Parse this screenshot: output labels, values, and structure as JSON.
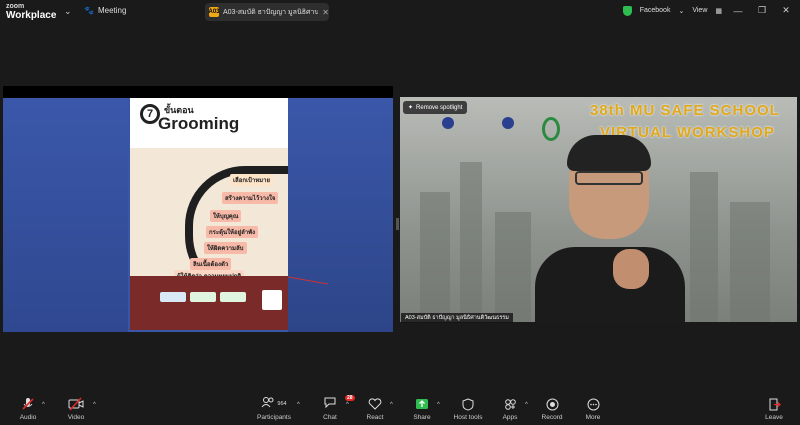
{
  "app": {
    "brand_line1": "zoom",
    "brand_line2": "Workplace"
  },
  "titlebar": {
    "meeting_label": "Meeting",
    "meeting_tab_icon": "A03",
    "meeting_tab_text": "A03-สมบัติ ธาปัญญา มูลนิธิศานติวัฒ",
    "facebook_label": "Facebook",
    "view_label": "View",
    "shield_color": "#2ebd4e"
  },
  "shared_screen": {
    "poster_number": "7",
    "poster_heading_top": "ขั้นตอน",
    "poster_heading_main": "Grooming",
    "steps": [
      "เลือกเป้าหมาย",
      "สร้างความไว้วางใจ",
      "ให้บุญคุณ",
      "กระตุ้นให้อยู่ลำพัง",
      "ให้ผิดความลับ",
      "ลินเนื้อต้องตัว",
      "ผู้ให้คิดว่า ความหยุมปกติ"
    ]
  },
  "video": {
    "spotlight_button": "Remove spotlight",
    "banner_line1": "38th MU SAFE SCHOOL",
    "banner_line2": "VIRTUAL WORKSHOP",
    "participant_name": "A03-สมบัติ ธาปัญญา มูลนิธิศานติวัฒนธรรม"
  },
  "toolbar": {
    "audio": "Audio",
    "video": "Video",
    "participants": "Participants",
    "participants_count": "964",
    "chat": "Chat",
    "chat_badge": "28",
    "react": "React",
    "share": "Share",
    "host_tools": "Host tools",
    "apps": "Apps",
    "record": "Record",
    "more": "More",
    "leave": "Leave",
    "share_color": "#2ebd4e",
    "muted_color": "#e02828"
  }
}
